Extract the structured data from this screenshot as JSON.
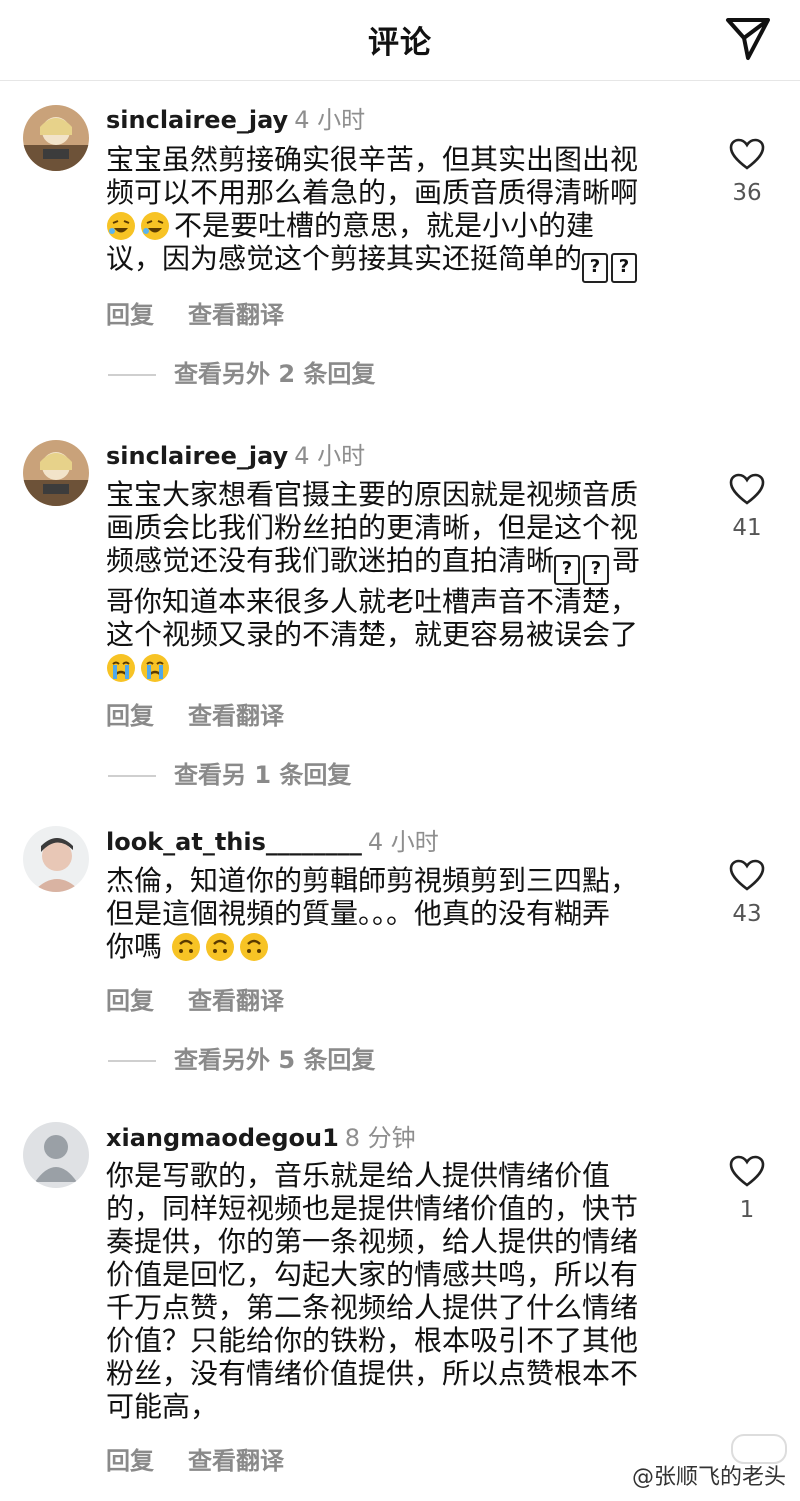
{
  "header": {
    "title": "评论",
    "send_icon": "paper-plane-icon"
  },
  "comments": [
    {
      "user": "sinclairee_jay",
      "time": "4 小时",
      "lines": [
        "宝宝虽然剪接确实很辛苦，但其实出图出视",
        "频可以不用那么着急的，画质音质得清晰啊",
        "不是要吐槽的意思，就是小小的建",
        "议，因为感觉这个剪接其实还挺简单的"
      ],
      "emoji": "rolling-laughing-face",
      "likes": "36",
      "reply": "回复",
      "translate": "查看翻译",
      "more_replies": "查看另外 2 条回复"
    },
    {
      "user": "sinclairee_jay",
      "time": "4 小时",
      "lines": [
        "宝宝大家想看官摄主要的原因就是视频音质",
        "画质会比我们粉丝拍的更清晰，但是这个视",
        "频感觉还没有我们歌迷拍的直拍清晰",
        "哥你知道本来很多人就老吐槽声音不清楚，",
        "这个视频又录的不清楚，就更容易被误会了"
      ],
      "line3_tail": "哥",
      "emoji": "crying-face",
      "likes": "41",
      "reply": "回复",
      "translate": "查看翻译",
      "more_replies": "查看另 1 条回复"
    },
    {
      "user": "look_at_this________",
      "time": "4 小时",
      "lines": [
        "杰倫，知道你的剪輯師剪視頻剪到三四點，",
        "但是這個視頻的質量。。。他真的没有糊弄",
        "你嗎"
      ],
      "emoji": "upside-down-face",
      "likes": "43",
      "reply": "回复",
      "translate": "查看翻译",
      "more_replies": "查看另外 5 条回复"
    },
    {
      "user": "xiangmaodegou1",
      "time": "8 分钟",
      "lines": [
        "你是写歌的，音乐就是给人提供情绪价值",
        "的，同样短视频也是提供情绪价值的，快节",
        "奏提供，你的第一条视频，给人提供的情绪",
        "价值是回忆，勾起大家的情感共鸣，所以有",
        "千万点赞，第二条视频给人提供了什么情绪",
        "价值？只能给你的铁粉，根本吸引不了其他",
        "粉丝，没有情绪价值提供，所以点赞根本不",
        "可能高，"
      ],
      "likes": "1",
      "reply": "回复",
      "translate": "查看翻译"
    }
  ],
  "unknown_glyph": "?",
  "watermark": "@张顺飞的老头",
  "colors": {
    "text": "#111111",
    "muted": "#8a8a8a",
    "divider": "#e6e6e6",
    "emoji_yellow": "#f7c325"
  }
}
